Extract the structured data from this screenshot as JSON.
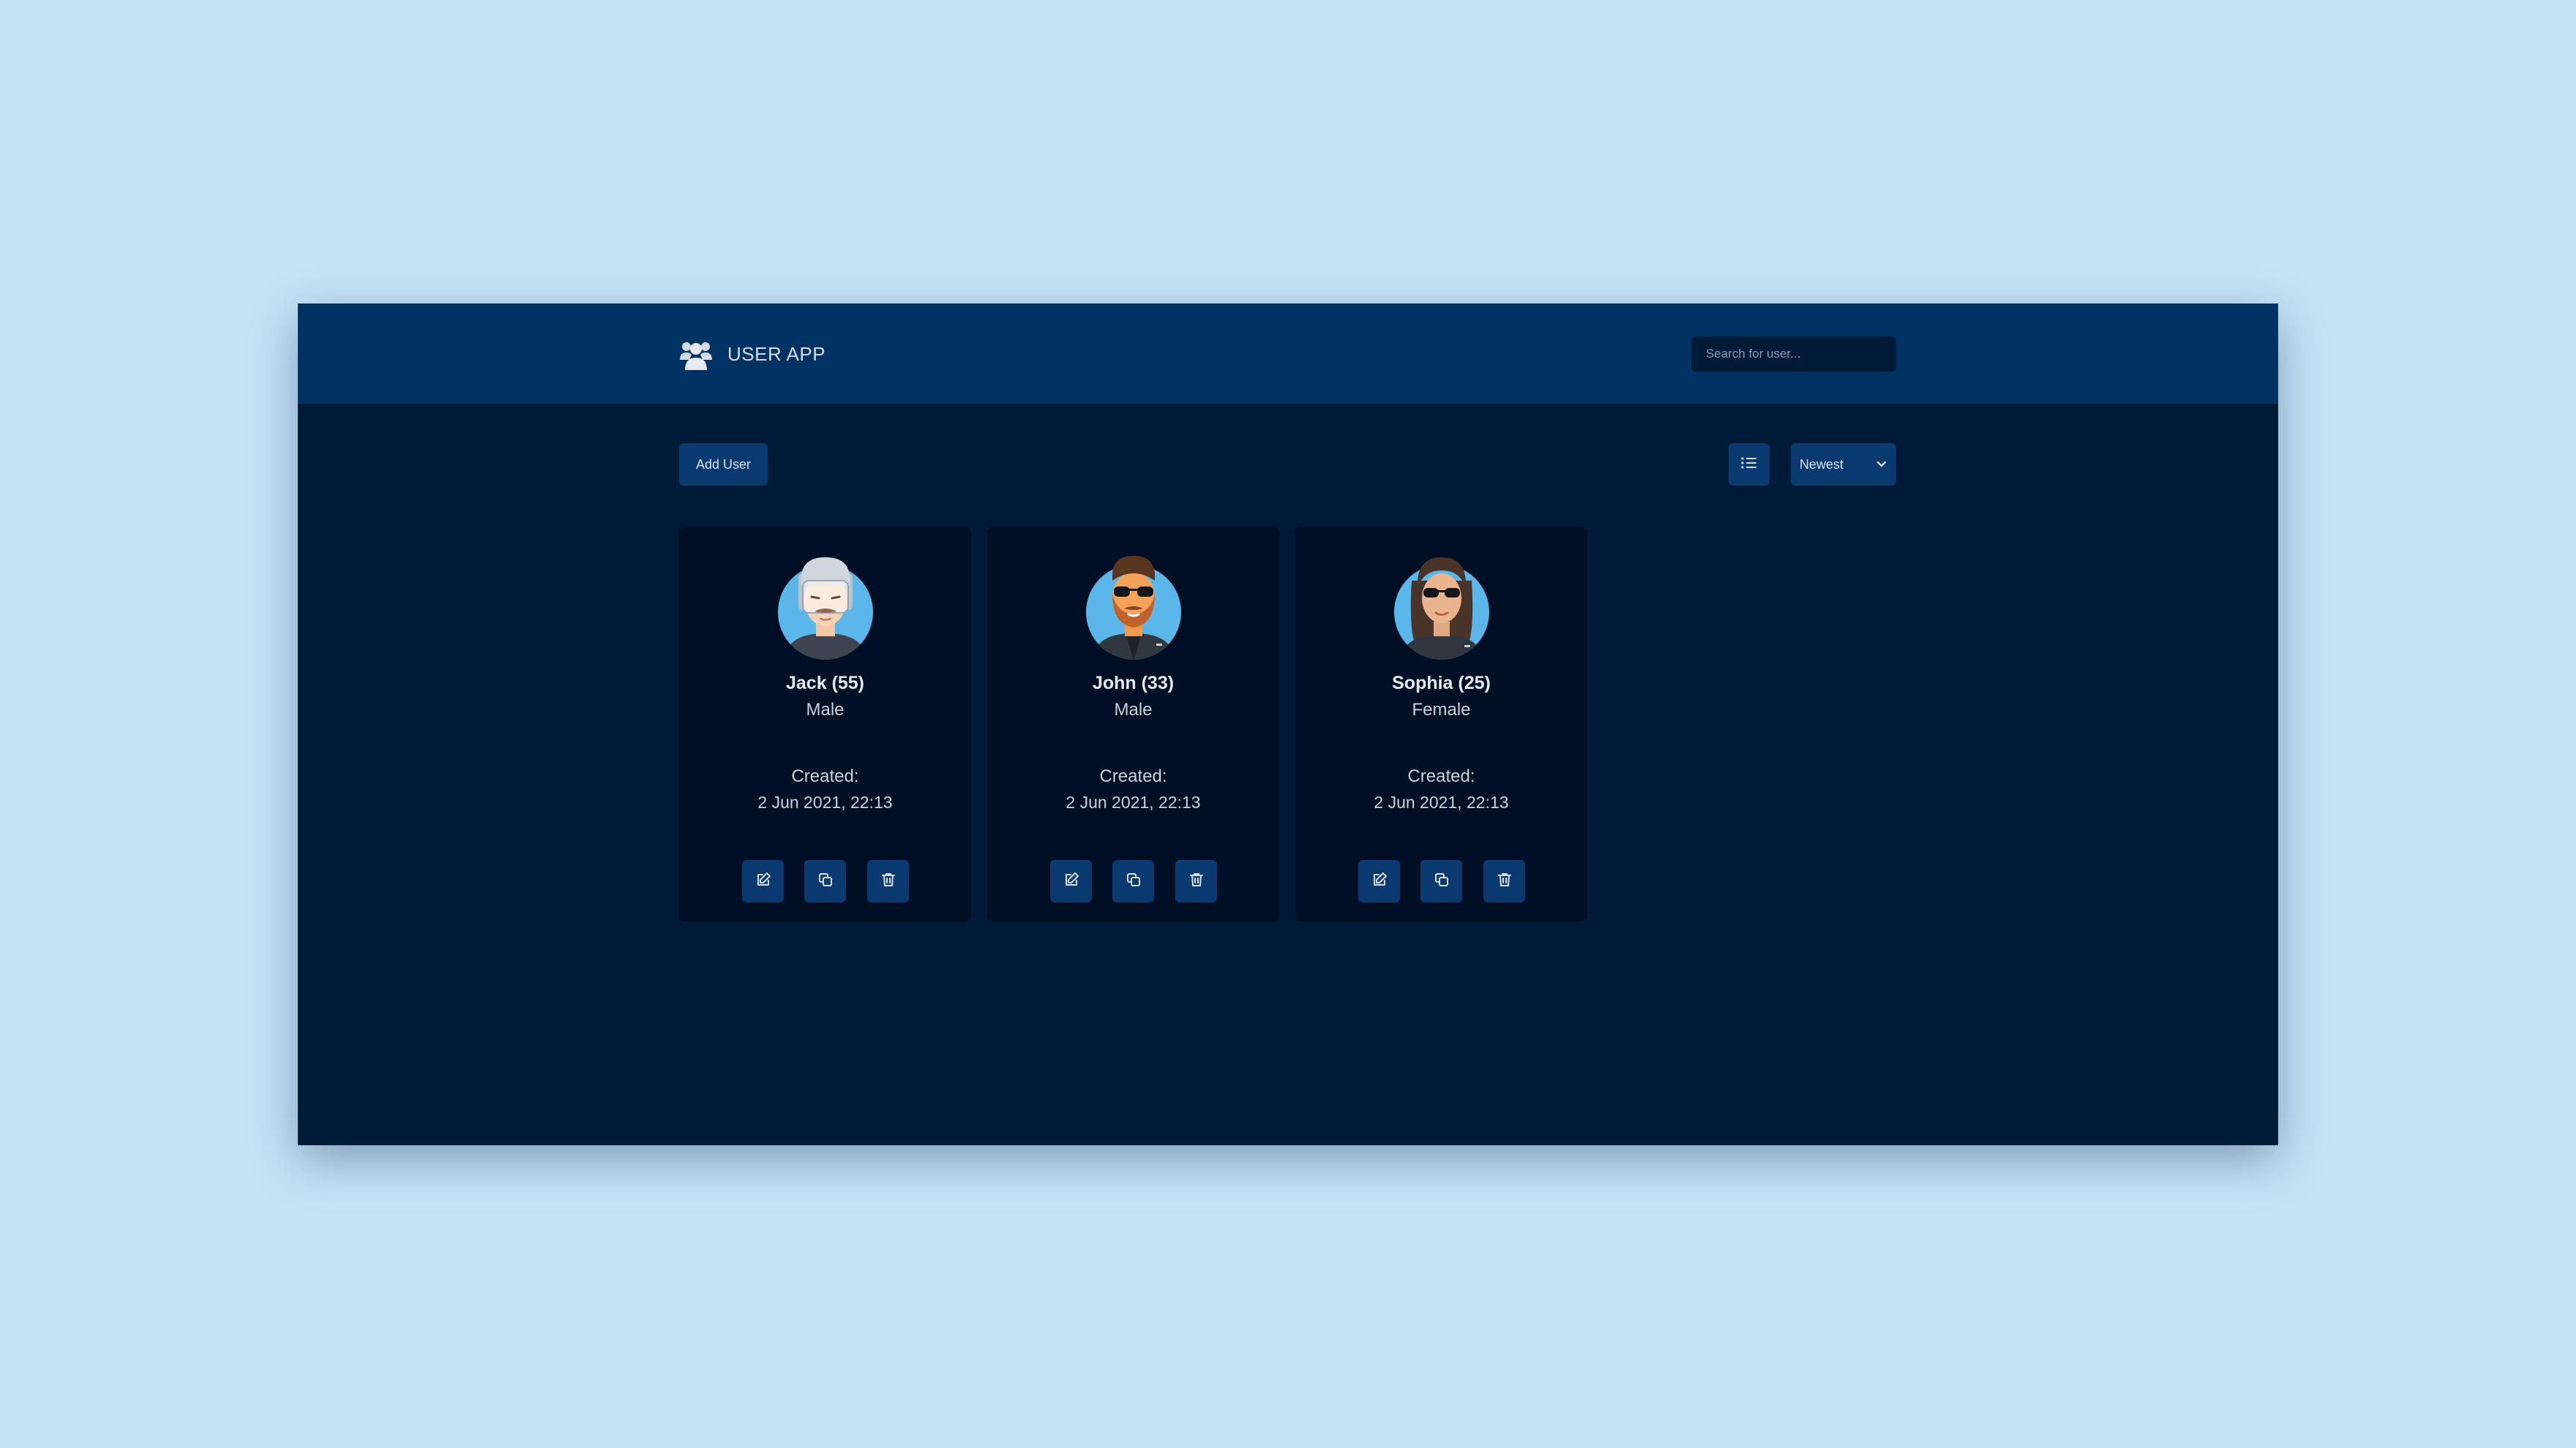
{
  "app": {
    "title": "USER APP",
    "icon": "users-icon"
  },
  "search": {
    "placeholder": "Search for user...",
    "value": ""
  },
  "toolbar": {
    "add_label": "Add User",
    "view_icon": "list-icon",
    "sort_value": "Newest",
    "sort_icon": "chevron-down-icon"
  },
  "users": [
    {
      "name": "Jack (55)",
      "gender": "Male",
      "created_label": "Created:",
      "created_date": "2 Jun 2021, 22:13",
      "avatar": "old-man-avatar-icon"
    },
    {
      "name": "John (33)",
      "gender": "Male",
      "created_label": "Created:",
      "created_date": "2 Jun 2021, 22:13",
      "avatar": "bearded-man-sunglasses-avatar-icon"
    },
    {
      "name": "Sophia (25)",
      "gender": "Female",
      "created_label": "Created:",
      "created_date": "2 Jun 2021, 22:13",
      "avatar": "woman-sunglasses-avatar-icon"
    }
  ],
  "card_actions": [
    "edit-icon",
    "copy-icon",
    "trash-icon"
  ],
  "colors": {
    "page_background": "#c6e3f5",
    "navbar": "#003263",
    "app_background": "#001a38",
    "card": "#000f24",
    "button": "#0a3a70",
    "avatar_background": "#5bb6ea"
  }
}
